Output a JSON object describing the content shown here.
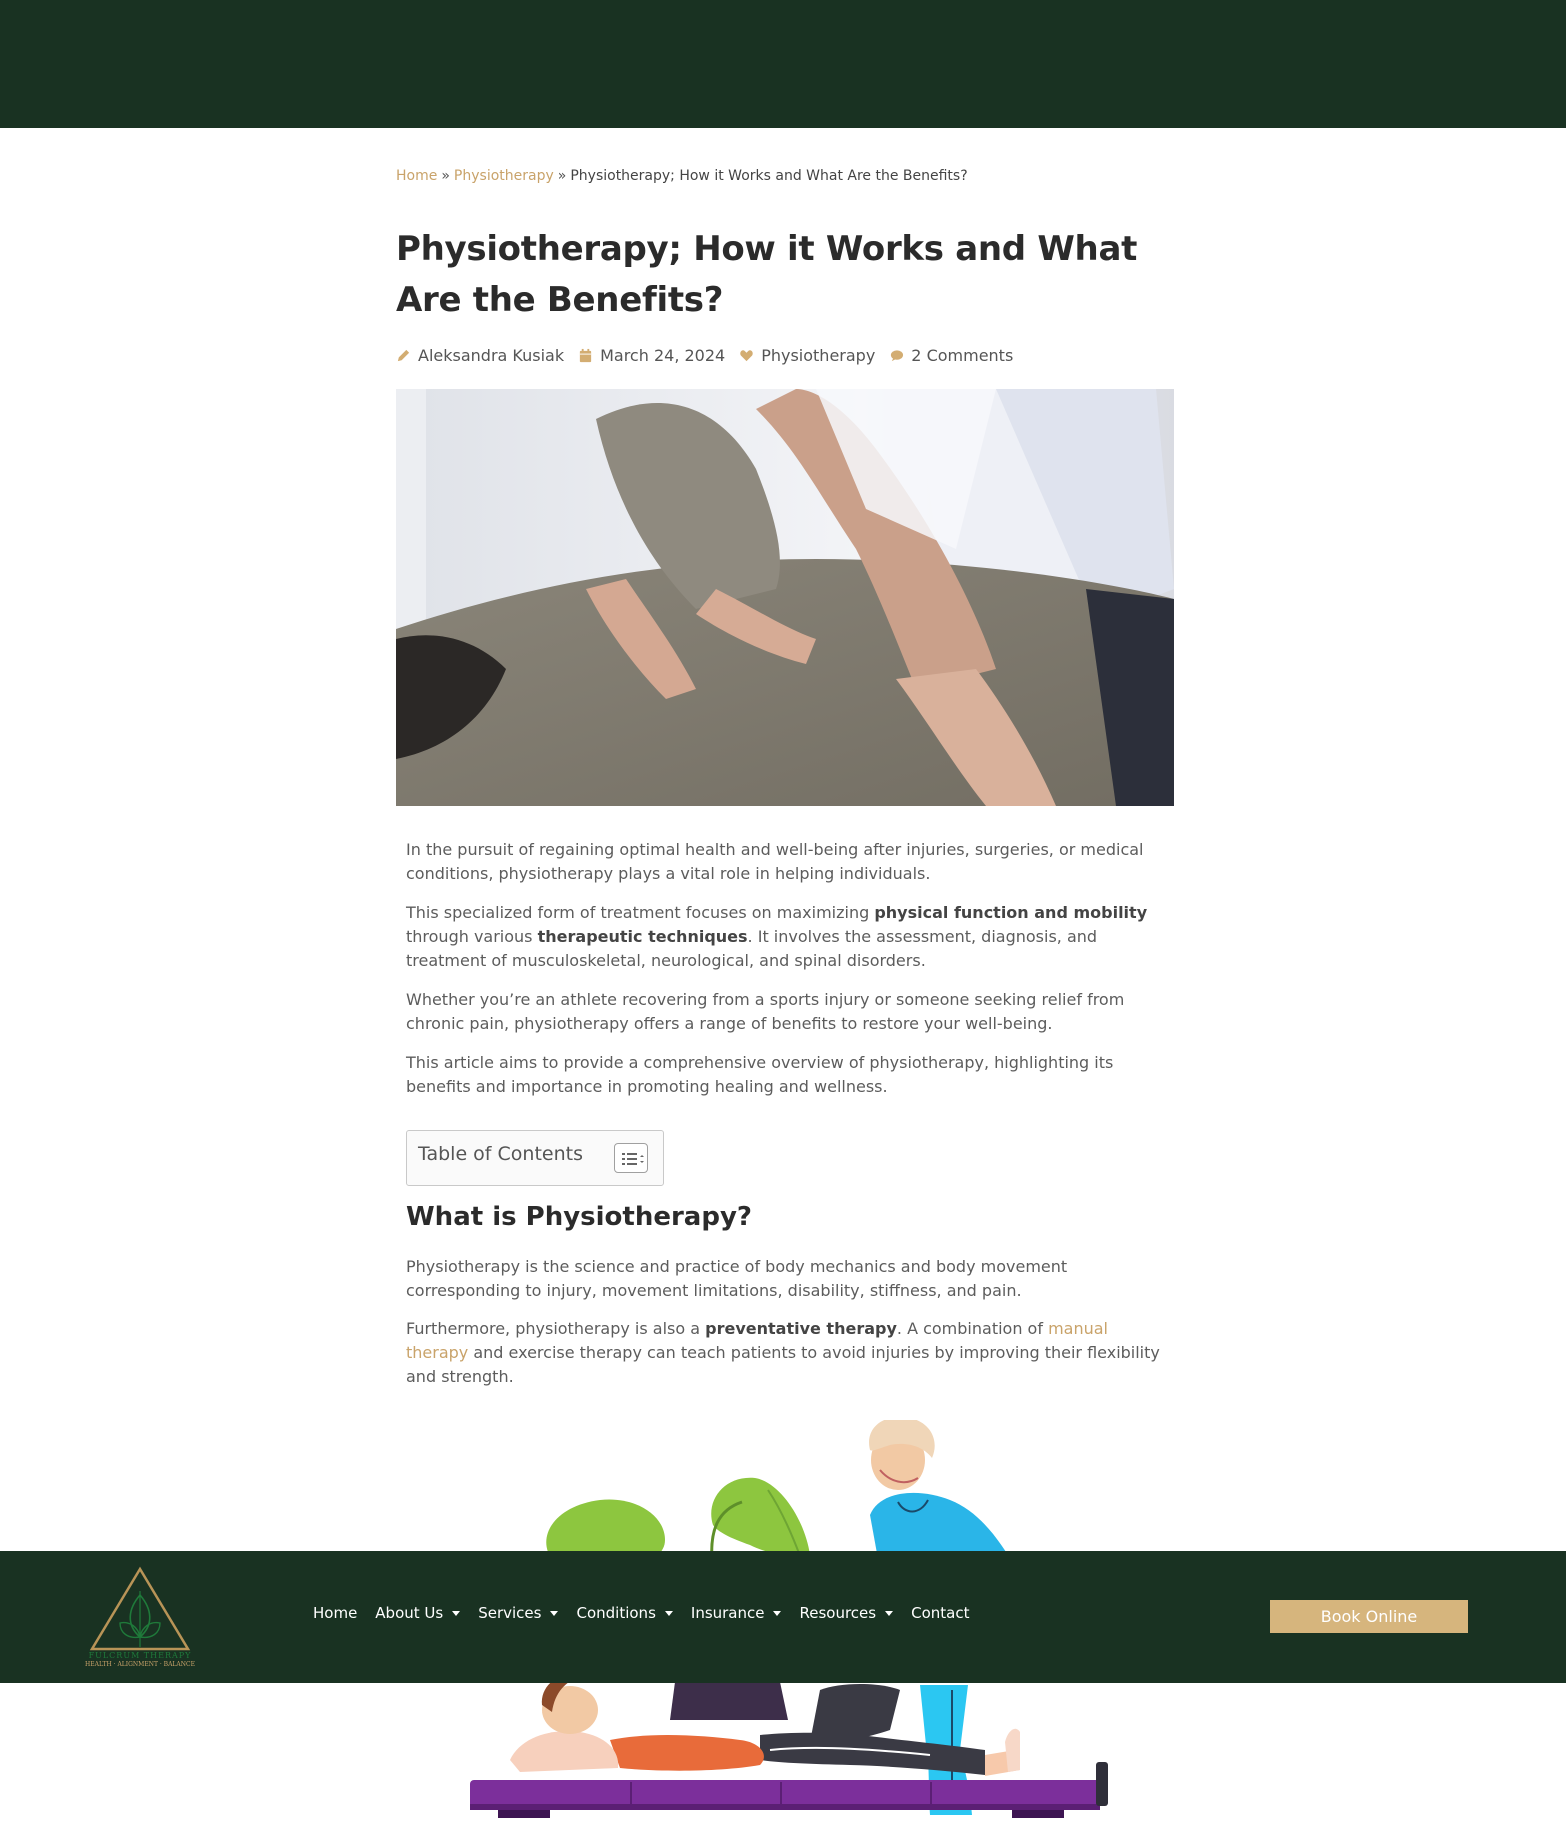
{
  "breadcrumb": {
    "home": "Home",
    "sep": "»",
    "category": "Physiotherapy",
    "current": "Physiotherapy; How it Works and What Are the Benefits?"
  },
  "article": {
    "title": "Physiotherapy; How it Works and What Are the Benefits?",
    "meta": {
      "author": "Aleksandra Kusiak",
      "date": "March 24, 2024",
      "category": "Physiotherapy",
      "comments": "2 Comments"
    },
    "intro": {
      "p1": "In the pursuit of regaining optimal health and well-being after injuries, surgeries, or medical conditions, physiotherapy plays a vital role in helping individuals.",
      "p2_a": "This specialized form of treatment focuses on maximizing ",
      "p2_b1": "physical function and mobility",
      "p2_c": " through various ",
      "p2_b2": "therapeutic techniques",
      "p2_d": ". It involves the assessment, diagnosis, and treatment of musculoskeletal, neurological, and spinal disorders.",
      "p3": "Whether you’re an athlete recovering from a sports injury or someone seeking relief from chronic pain, physiotherapy offers a range of benefits to restore your well-being.",
      "p4": "This article aims to provide a comprehensive overview of physiotherapy, highlighting its benefits and importance in promoting healing and wellness."
    },
    "toc_label": "Table of Contents",
    "section_heading": "What is Physiotherapy?",
    "section": {
      "p1": "Physiotherapy is the science and practice of body mechanics and body movement corresponding to injury, movement limitations, disability, stiffness, and pain.",
      "p2_a": "Furthermore, physiotherapy is also a ",
      "p2_b": "preventative therapy",
      "p2_c": ". A combination of ",
      "p2_link": "manual therapy",
      "p2_d": " and exercise therapy can teach patients to avoid injuries by improving their flexibility and strength."
    }
  },
  "navbar": {
    "logo_name": "FULCRUM THERAPY",
    "logo_tagline": "HEALTH · ALIGNMENT · BALANCE",
    "items": [
      {
        "label": "Home"
      },
      {
        "label": "About Us"
      },
      {
        "label": "Services"
      },
      {
        "label": "Conditions"
      },
      {
        "label": "Insurance"
      },
      {
        "label": "Resources"
      },
      {
        "label": "Contact"
      }
    ],
    "book_label": "Book Online"
  },
  "colors": {
    "dark_green": "#193222",
    "gold": "#c9a36a",
    "button_gold": "#d6b57d"
  },
  "icons": [
    "pencil-icon",
    "calendar-icon",
    "heart-icon",
    "comment-icon",
    "list-toggle-icon",
    "chevron-down-icon"
  ]
}
